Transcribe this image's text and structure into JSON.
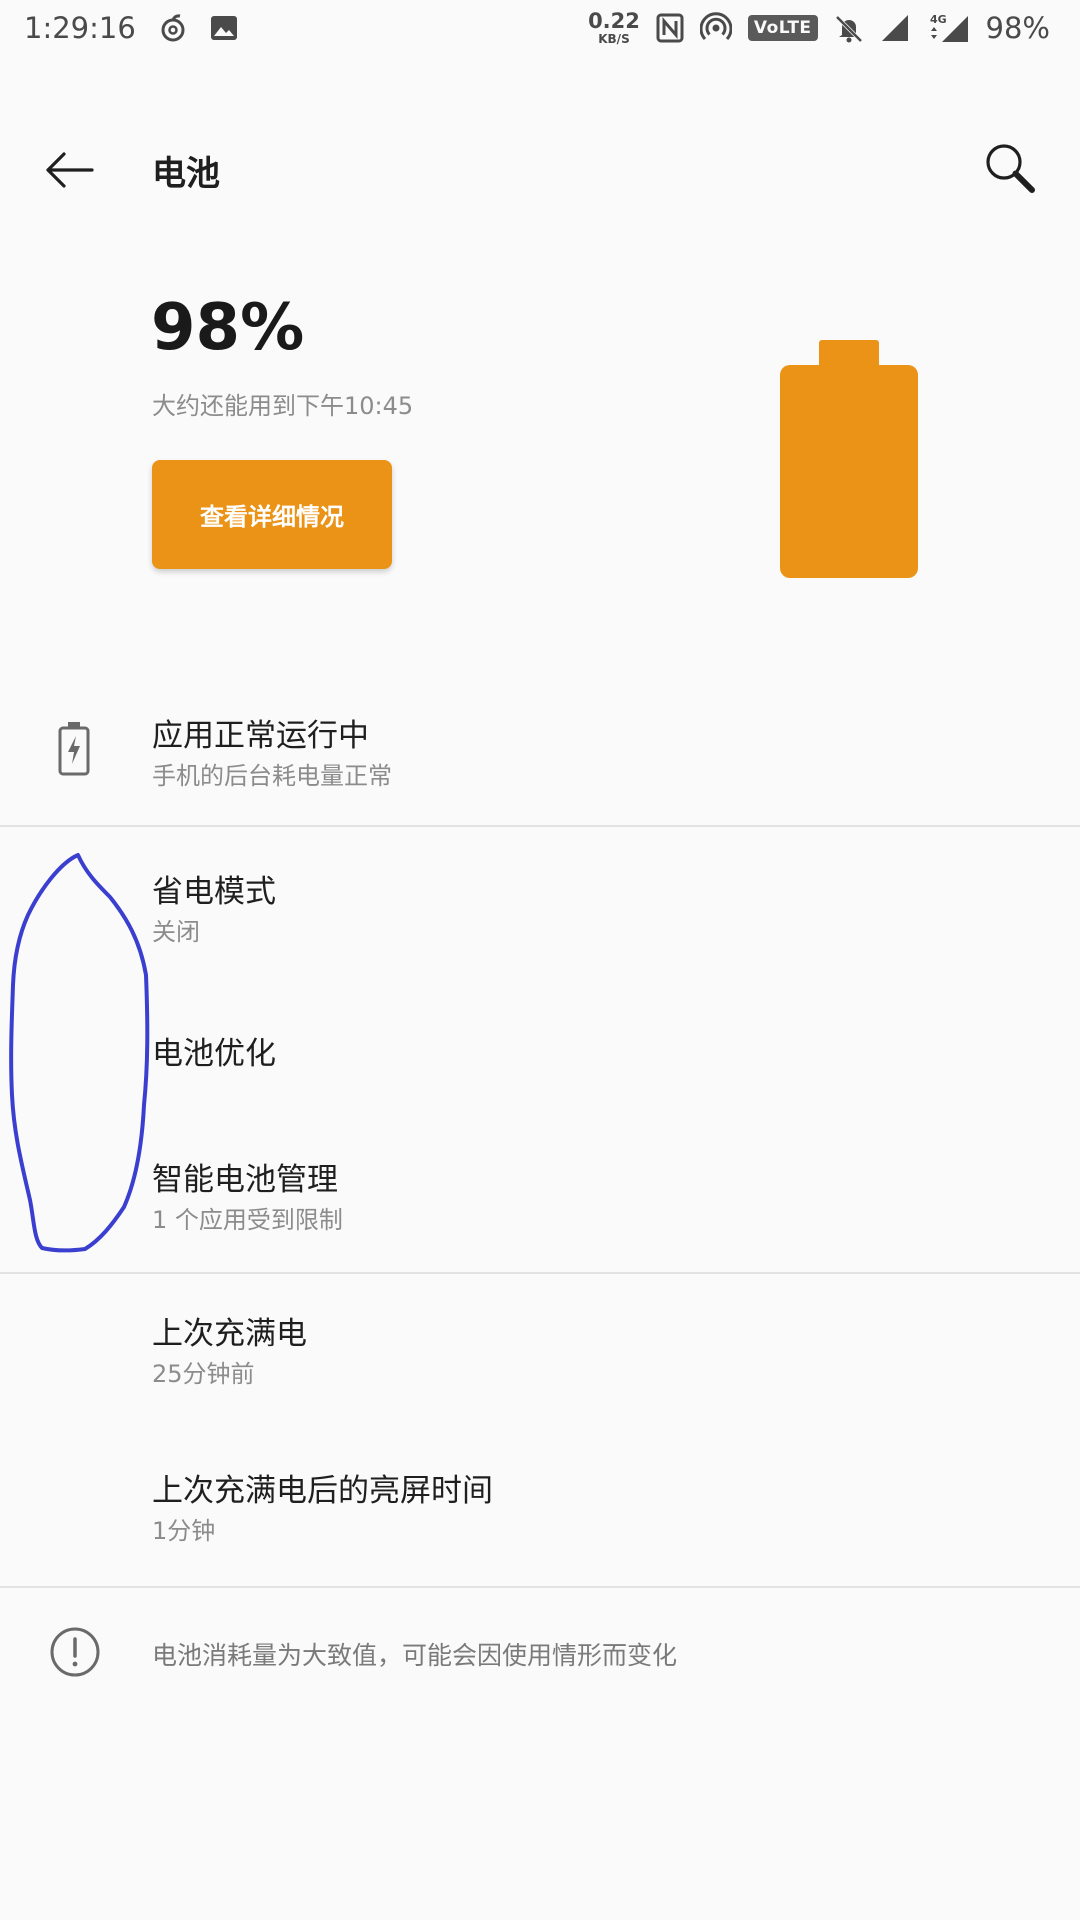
{
  "status_bar": {
    "time": "1:29:16",
    "net_speed_value": "0.22",
    "net_speed_unit": "KB/S",
    "volte_label": "VoLTE",
    "network_type": "4G",
    "battery_percent": "98%",
    "icons": [
      "netease-music-icon",
      "image-icon",
      "nfc-icon",
      "hotspot-icon",
      "volte-icon",
      "bell-off-icon",
      "signal-icon",
      "signal-4g-icon"
    ]
  },
  "toolbar": {
    "title": "电池",
    "back_icon": "arrow-left-icon",
    "search_icon": "search-icon"
  },
  "battery": {
    "percent": "98%",
    "level": 0.98,
    "estimate": "大约还能用到下午10:45",
    "details_button": "查看详细情况",
    "accent_color": "#eb9316"
  },
  "list": {
    "app_status": {
      "title": "应用正常运行中",
      "subtitle": "手机的后台耗电量正常",
      "icon": "battery-charging-icon"
    },
    "power_saving": {
      "title": "省电模式",
      "subtitle": "关闭"
    },
    "battery_optimization": {
      "title": "电池优化"
    },
    "smart_battery": {
      "title": "智能电池管理",
      "subtitle": "1 个应用受到限制"
    },
    "last_full_charge": {
      "title": "上次充满电",
      "subtitle": "25分钟前"
    },
    "screen_on_time": {
      "title": "上次充满电后的亮屏时间",
      "subtitle": "1分钟"
    }
  },
  "footer": {
    "note": "电池消耗量为大致值，可能会因使用情形而变化",
    "icon": "info-icon"
  },
  "annotation_color": "#3b3fd0"
}
